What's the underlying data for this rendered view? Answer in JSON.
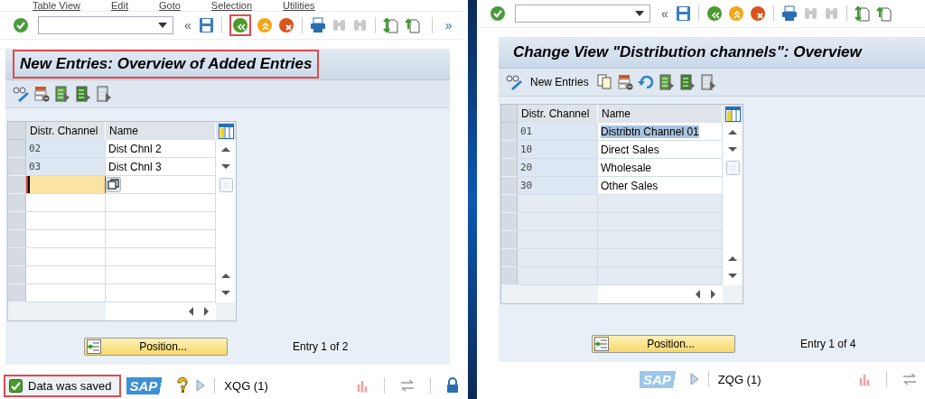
{
  "windows": [
    {
      "menu": [
        {
          "label": "Table View"
        },
        {
          "label": "Edit"
        },
        {
          "label": "Goto"
        },
        {
          "label": "Selection"
        },
        {
          "label": "Utilities"
        }
      ],
      "toolbar": {
        "expand_glyph": "«",
        "more_glyph": "»",
        "back_highlighted": true
      },
      "title": "New Entries: Overview of Added Entries",
      "title_highlighted": true,
      "table": {
        "columns": [
          "Distr. Channel",
          "Name"
        ],
        "rows": [
          {
            "kind": "data",
            "cells": [
              "02",
              "Dist Chnl 2"
            ],
            "selected": false
          },
          {
            "kind": "data",
            "cells": [
              "03",
              "Dist Chnl 3"
            ],
            "selected": false
          },
          {
            "kind": "input"
          },
          {
            "kind": "empty",
            "editable": true
          },
          {
            "kind": "empty",
            "editable": true
          },
          {
            "kind": "empty",
            "editable": true
          },
          {
            "kind": "empty",
            "editable": true
          },
          {
            "kind": "empty",
            "editable": true
          },
          {
            "kind": "empty",
            "editable": true
          }
        ]
      },
      "position_button": "Position...",
      "entry_info": "Entry 1 of 2",
      "status": {
        "message": "Data was saved",
        "highlighted": true,
        "help": true,
        "logo": "SAP",
        "system": "XQG (1)"
      }
    },
    {
      "toolbar": {
        "expand_glyph": "«"
      },
      "title": "Change View \"Distribution channels\": Overview",
      "title_highlighted": false,
      "new_entries_button": "New Entries",
      "table": {
        "columns": [
          "Distr. Channel",
          "Name"
        ],
        "rows": [
          {
            "kind": "data",
            "cells": [
              "01",
              "Distribtn Channel 01"
            ],
            "selected": true
          },
          {
            "kind": "data",
            "cells": [
              "10",
              "Direct Sales"
            ],
            "selected": false
          },
          {
            "kind": "data",
            "cells": [
              "20",
              "Wholesale"
            ],
            "selected": false
          },
          {
            "kind": "data",
            "cells": [
              "30",
              "Other Sales"
            ],
            "selected": false
          },
          {
            "kind": "empty",
            "editable": false
          },
          {
            "kind": "empty",
            "editable": false
          },
          {
            "kind": "empty",
            "editable": false
          },
          {
            "kind": "empty",
            "editable": false
          },
          {
            "kind": "empty",
            "editable": false
          }
        ]
      },
      "position_button": "Position...",
      "entry_info": "Entry 1 of 4",
      "status": {
        "logo": "SAP",
        "system": "ZQG (1)"
      }
    }
  ]
}
